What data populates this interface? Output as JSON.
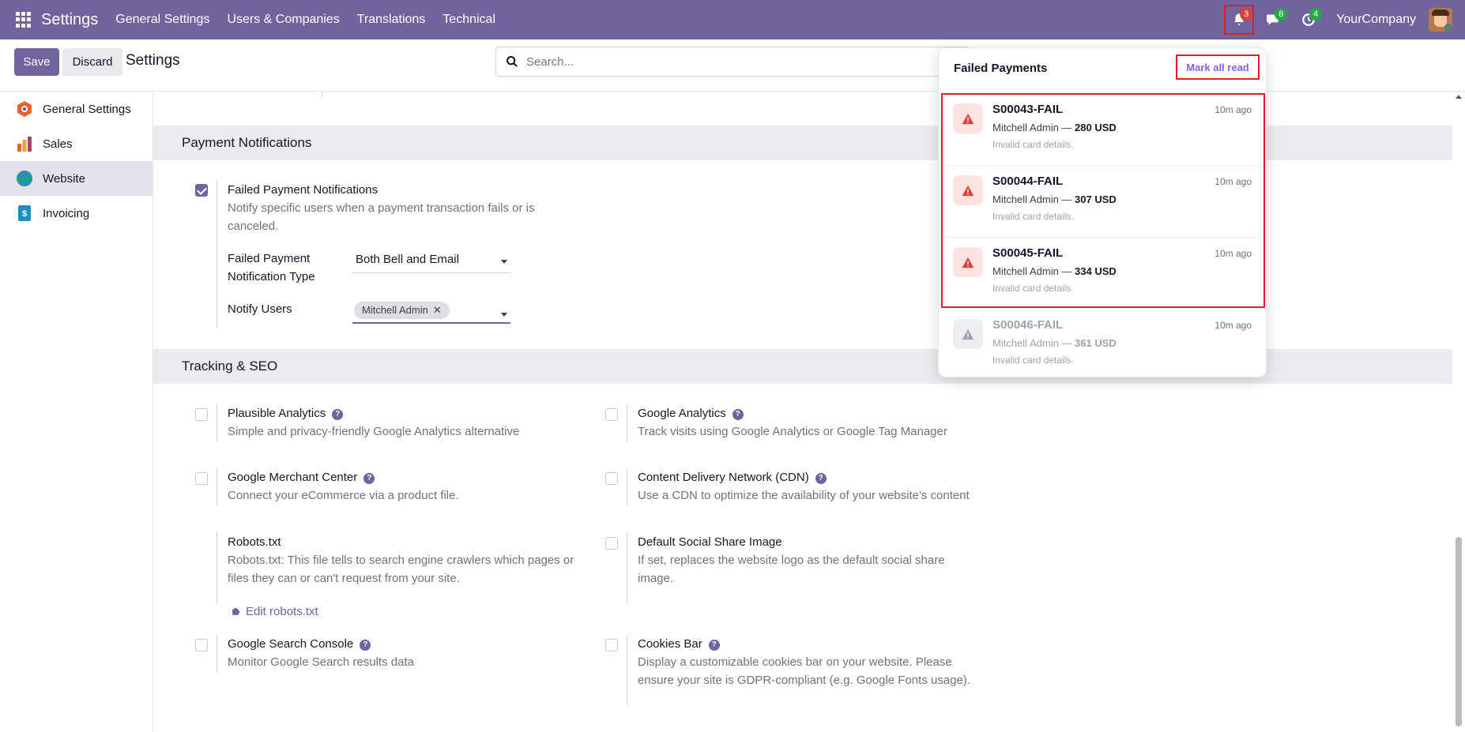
{
  "navbar": {
    "brand": "Settings",
    "menu": [
      "General Settings",
      "Users & Companies",
      "Translations",
      "Technical"
    ],
    "bell_count": "3",
    "chat_count": "8",
    "activity_count": "4",
    "company": "YourCompany"
  },
  "control": {
    "save_label": "Save",
    "discard_label": "Discard",
    "title": "Settings",
    "search_placeholder": "Search..."
  },
  "sidebar": {
    "items": [
      {
        "label": "General Settings"
      },
      {
        "label": "Sales"
      },
      {
        "label": "Website"
      },
      {
        "label": "Invoicing"
      }
    ]
  },
  "payment_section": {
    "heading": "Payment Notifications",
    "failed_title": "Failed Payment Notifications",
    "failed_desc": "Notify specific users when a payment transaction fails or is canceled.",
    "type_label": "Failed Payment Notification Type",
    "type_value": "Both Bell and Email",
    "users_label": "Notify Users",
    "users_tag": "Mitchell Admin"
  },
  "tracking_section": {
    "heading": "Tracking & SEO",
    "settings": [
      {
        "title": "Plausible Analytics",
        "desc": "Simple and privacy-friendly Google Analytics alternative"
      },
      {
        "title": "Google Analytics",
        "desc": "Track visits using Google Analytics or Google Tag Manager"
      },
      {
        "title": "Google Merchant Center",
        "desc": "Connect your eCommerce via a product file."
      },
      {
        "title": "Content Delivery Network (CDN)",
        "desc": "Use a CDN to optimize the availability of your website's content"
      },
      {
        "title": "Robots.txt",
        "desc": "Robots.txt: This file tells to search engine crawlers which pages or files they can or can't request from your site."
      },
      {
        "title": "Default Social Share Image",
        "desc": "If set, replaces the website logo as the default social share image."
      },
      {
        "title": "Google Search Console",
        "desc": "Monitor Google Search results data"
      },
      {
        "title": "Cookies Bar",
        "desc": "Display a customizable cookies bar on your website. Please ensure your site is GDPR-compliant (e.g. Google Fonts usage)."
      }
    ],
    "robots_link": "Edit robots.txt"
  },
  "dropdown": {
    "title": "Failed Payments",
    "mark_all_read": "Mark all read",
    "notifications": [
      {
        "ref": "S00043-FAIL",
        "time": "10m ago",
        "user": "Mitchell Admin —",
        "amount": "280 USD",
        "detail": "Invalid card details."
      },
      {
        "ref": "S00044-FAIL",
        "time": "10m ago",
        "user": "Mitchell Admin —",
        "amount": "307 USD",
        "detail": "Invalid card details."
      },
      {
        "ref": "S00045-FAIL",
        "time": "10m ago",
        "user": "Mitchell Admin —",
        "amount": "334 USD",
        "detail": "Invalid card details."
      },
      {
        "ref": "S00046-FAIL",
        "time": "10m ago",
        "user": "Mitchell Admin —",
        "amount": "361 USD",
        "detail": "Invalid card details."
      }
    ]
  },
  "colors": {
    "brand": "#71639e",
    "alert_red": "#e11d2a",
    "danger_icon": "#d9423a"
  }
}
